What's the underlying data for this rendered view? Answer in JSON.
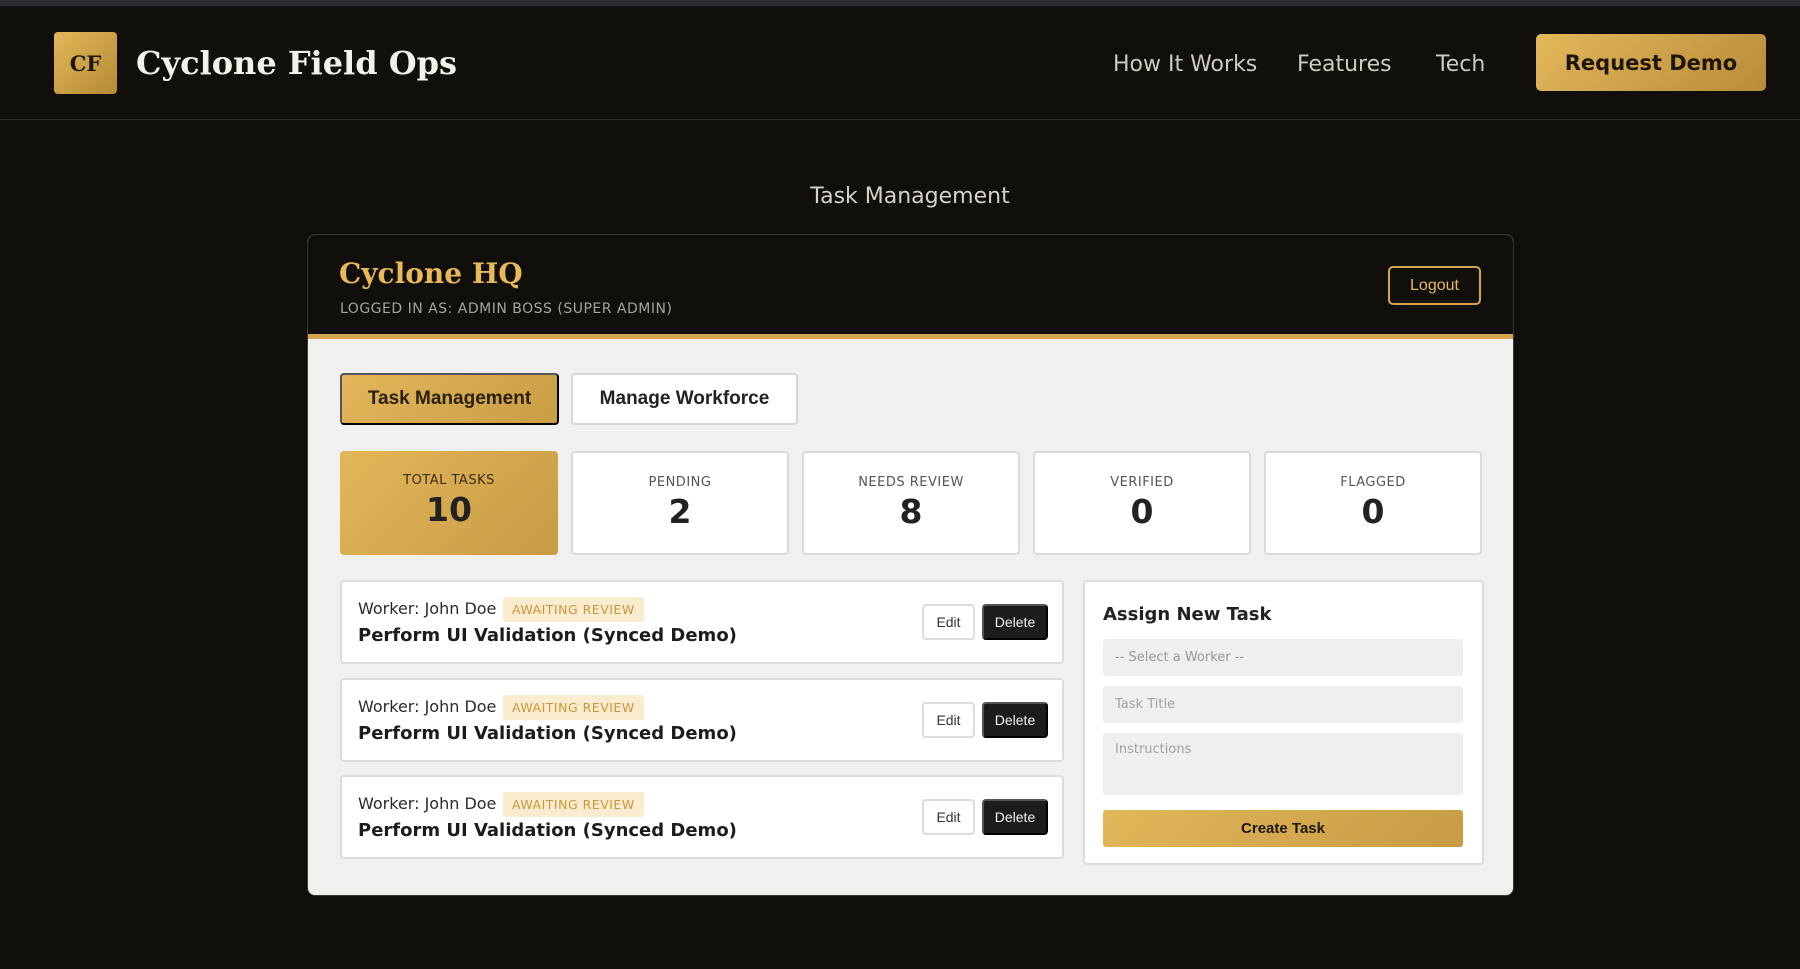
{
  "nav": {
    "logo_initials": "CF",
    "brand": "Cyclone Field Ops",
    "links": [
      "How It Works",
      "Features",
      "Tech"
    ],
    "cta": "Request Demo"
  },
  "section_heading": "Task Management",
  "panel": {
    "title": "Cyclone HQ",
    "subtitle": "LOGGED IN AS: ADMIN BOSS (SUPER ADMIN)",
    "logout": "Logout",
    "tabs": [
      {
        "label": "Task Management",
        "active": true
      },
      {
        "label": "Manage Workforce",
        "active": false
      }
    ],
    "stats": [
      {
        "label": "TOTAL TASKS",
        "value": "10",
        "active": true
      },
      {
        "label": "PENDING",
        "value": "2",
        "active": false
      },
      {
        "label": "NEEDS REVIEW",
        "value": "8",
        "active": false
      },
      {
        "label": "VERIFIED",
        "value": "0",
        "active": false
      },
      {
        "label": "FLAGGED",
        "value": "0",
        "active": false
      }
    ],
    "tasks": [
      {
        "worker": "Worker: John Doe",
        "status": "AWAITING REVIEW",
        "title": "Perform UI Validation (Synced Demo)",
        "edit": "Edit",
        "delete": "Delete"
      },
      {
        "worker": "Worker: John Doe",
        "status": "AWAITING REVIEW",
        "title": "Perform UI Validation (Synced Demo)",
        "edit": "Edit",
        "delete": "Delete"
      },
      {
        "worker": "Worker: John Doe",
        "status": "AWAITING REVIEW",
        "title": "Perform UI Validation (Synced Demo)",
        "edit": "Edit",
        "delete": "Delete"
      }
    ],
    "assign": {
      "title": "Assign New Task",
      "worker_select_placeholder": "-- Select a Worker --",
      "task_title_placeholder": "Task Title",
      "instructions_placeholder": "Instructions",
      "submit": "Create Task"
    }
  },
  "colors": {
    "accent_gold": "#d3a54e",
    "background": "#110f0c",
    "panel_bg": "#f0f0f0",
    "badge_bg": "#fbeccf"
  }
}
